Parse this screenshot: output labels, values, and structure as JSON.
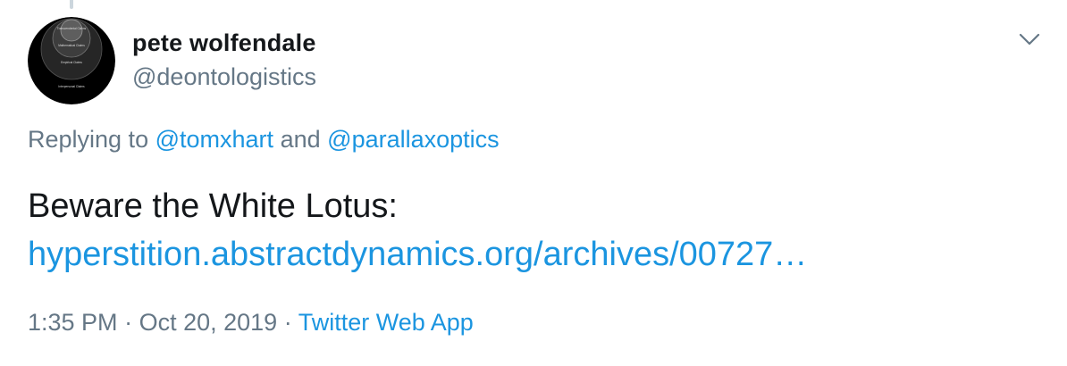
{
  "tweet": {
    "author": {
      "display_name": "pete wolfendale",
      "handle": "@deontologistics",
      "avatar_circles": [
        "Transcendental Claims",
        "Mathematical Claims",
        "Empirical Claims",
        "Interpersonal Claims"
      ]
    },
    "replying": {
      "prefix": "Replying to",
      "user1": "@tomxhart",
      "joiner": "and",
      "user2": "@parallaxoptics"
    },
    "text": "Beware the White Lotus:",
    "link": "hyperstition.abstractdynamics.org/archives/00727…",
    "time": "1:35 PM",
    "date": "Oct 20, 2019",
    "separator": "·",
    "source": "Twitter Web App"
  },
  "icons": {
    "menu": "chevron-down-icon"
  },
  "colors": {
    "link": "#1b95e0",
    "secondary_text": "#657786",
    "primary_text": "#14171a"
  }
}
